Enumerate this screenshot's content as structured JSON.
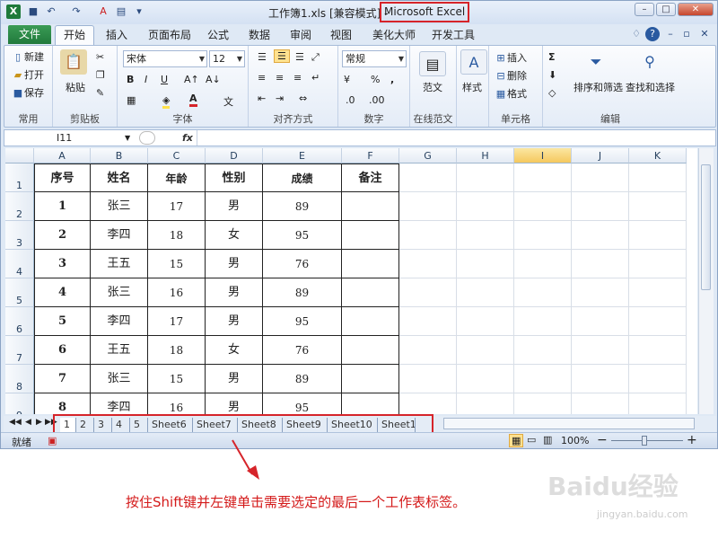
{
  "window": {
    "title": "工作簿1.xls  [兼容模式] - ",
    "app_name": "Microsoft Excel",
    "min_icon": "minimize-icon",
    "max_icon": "maximize-icon",
    "close_icon": "close-icon"
  },
  "quick_access": [
    "save-icon",
    "undo-icon",
    "redo-icon",
    "font-color-icon",
    "customize-icon"
  ],
  "tabs": {
    "file": "文件",
    "items": [
      "开始",
      "插入",
      "页面布局",
      "公式",
      "数据",
      "审阅",
      "视图",
      "美化大师",
      "开发工具"
    ]
  },
  "ribbon": {
    "common": {
      "label": "常用",
      "new": "新建",
      "open": "打开",
      "save": "保存"
    },
    "clipboard": {
      "label": "剪贴板",
      "paste": "粘贴"
    },
    "font": {
      "label": "字体",
      "name": "宋体",
      "size": "12",
      "bold": "B",
      "italic": "I",
      "underline": "U",
      "color_letter": "A"
    },
    "align": {
      "label": "对齐方式"
    },
    "number": {
      "label": "数字",
      "format": "常规",
      "percent": "%",
      "comma": ","
    },
    "online": {
      "label": "在线范文",
      "fanwen": "范文"
    },
    "styles": {
      "style": "样式"
    },
    "cells": {
      "label": "单元格",
      "insert": "插入",
      "delete": "删除",
      "format": "格式"
    },
    "edit": {
      "label": "编辑",
      "sort": "排序和筛选",
      "find": "查找和选择"
    }
  },
  "formula_bar": {
    "name_box": "I11",
    "fx": "fx",
    "value": ""
  },
  "columns": [
    "A",
    "B",
    "C",
    "D",
    "E",
    "F",
    "G",
    "H",
    "I",
    "J",
    "K"
  ],
  "rows": [
    "1",
    "2",
    "3",
    "4",
    "5",
    "6",
    "7",
    "8",
    "9"
  ],
  "table": {
    "headers": [
      "序号",
      "姓名",
      "年龄",
      "性别",
      "成绩",
      "备注"
    ],
    "data": [
      [
        "1",
        "张三",
        "17",
        "男",
        "89",
        ""
      ],
      [
        "2",
        "李四",
        "18",
        "女",
        "95",
        ""
      ],
      [
        "3",
        "王五",
        "15",
        "男",
        "76",
        ""
      ],
      [
        "4",
        "张三",
        "16",
        "男",
        "89",
        ""
      ],
      [
        "5",
        "李四",
        "17",
        "男",
        "95",
        ""
      ],
      [
        "6",
        "王五",
        "18",
        "女",
        "76",
        ""
      ],
      [
        "7",
        "张三",
        "15",
        "男",
        "89",
        ""
      ],
      [
        "8",
        "李四",
        "16",
        "男",
        "95",
        ""
      ]
    ]
  },
  "sheets": [
    "1",
    "2",
    "3",
    "4",
    "5",
    "Sheet6",
    "Sheet7",
    "Sheet8",
    "Sheet9",
    "Sheet10",
    "Sheet1"
  ],
  "status": {
    "ready": "就绪",
    "zoom": "100%",
    "zoom_minus": "−",
    "zoom_plus": "+"
  },
  "caption": "按住Shift键并左键单击需要选定的最后一个工作表标签。",
  "watermark": "Baidu经验",
  "watermark_sub": "jingyan.baidu.com",
  "colors": {
    "accent_red": "#d6242a",
    "excel_green": "#217a3c"
  }
}
